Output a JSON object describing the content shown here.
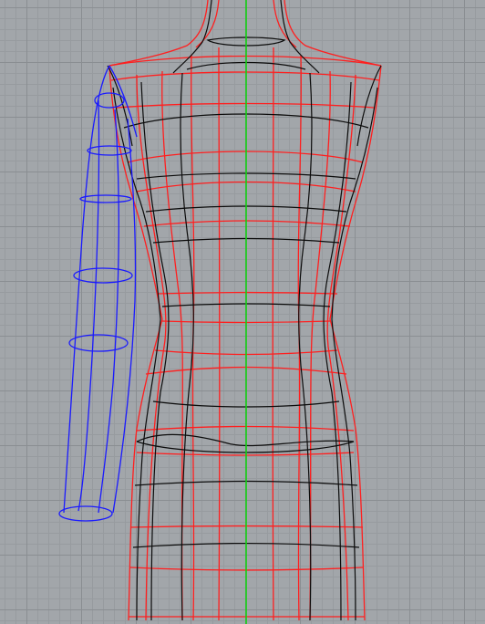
{
  "viewport": {
    "background": "#a2a6aa",
    "grid_major": "#8a8e92",
    "grid_minor": "#979b9f"
  },
  "colors": {
    "torso_outline": "#ff1f1f",
    "isocurves": "#0c0c0c",
    "sleeve": "#1a1aff",
    "center_axis": "#12d012"
  }
}
